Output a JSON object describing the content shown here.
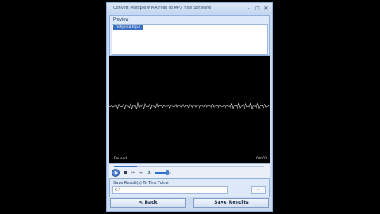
{
  "window": {
    "title": "Convert Multiple WMA Files To MP3 Files Software",
    "minimize": "–",
    "maximize": "□",
    "close": "✕"
  },
  "preview": {
    "label": "Preview",
    "items": [
      "richjedia.mp3"
    ],
    "selected_index": 0
  },
  "player": {
    "time_current": "Paused",
    "time_total": "00:00",
    "seek_progress": 0.15,
    "volume_level": 0.75,
    "prev_glyph": "⏮",
    "next_glyph": "⏭",
    "volume_glyph": "🔈"
  },
  "save": {
    "label": "Save Result(s) To This Folder",
    "path": "C:\\",
    "browse_label": "..."
  },
  "nav": {
    "back_label": "< Back",
    "save_label": "Save Results"
  },
  "colors": {
    "window_bg": "#c9daf1",
    "accent": "#2f6fd0",
    "player_bg": "#000000",
    "waveform": "#d8d8d8"
  }
}
